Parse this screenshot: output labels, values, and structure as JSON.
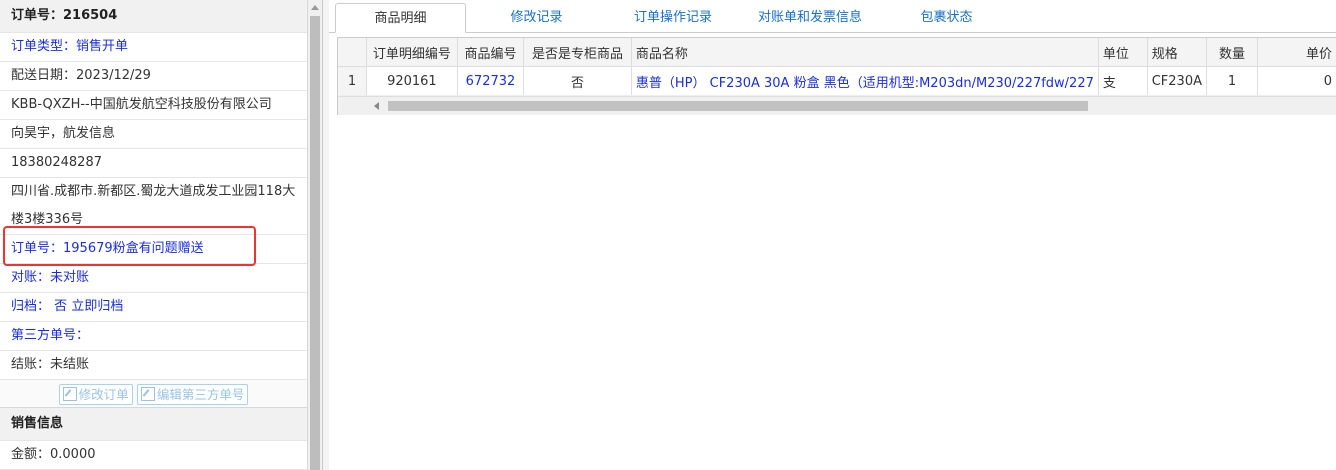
{
  "order": {
    "title": "订单号：216504",
    "type": "订单类型：销售开单",
    "delivery_date": "配送日期：2023/12/29",
    "customer": "KBB-QXZH--中国航发航空科技股份有限公司",
    "contact": "向昊宇，航发信息",
    "phone": "18380248287",
    "address": "四川省.成都市.新都区.蜀龙大道成发工业园118大楼3楼336号",
    "order_note": "订单号：195679粉盒有问题赠送",
    "reconcile": "对账：未对账",
    "archive_label": "归档：",
    "archive_value": "否",
    "archive_link": "立即归档",
    "third_party": "第三方单号：",
    "settle": "结账：未结账",
    "edit_order_btn": "修改订单",
    "edit_third_btn": "编辑第三方单号"
  },
  "sales": {
    "title": "销售信息",
    "amount": "金额：0.0000"
  },
  "tabs": [
    "商品明细",
    "修改记录",
    "订单操作记录",
    "对账单和发票信息",
    "包裹状态"
  ],
  "table": {
    "columns": [
      "",
      "订单明细编号",
      "商品编号",
      "是否是专柜商品",
      "商品名称",
      "单位",
      "规格",
      "数量",
      "单价"
    ],
    "rows": [
      [
        "1",
        "920161",
        "672732",
        "否",
        "惠普（HP） CF230A 30A 粉盒 黑色（适用机型:M203dn/M230/227fdw/227",
        "支",
        "CF230A",
        "1",
        "0"
      ]
    ]
  },
  "colors": {
    "link": "#1a2ee0",
    "tab_link": "#1a6fc8",
    "highlight_box": "#e33333"
  }
}
